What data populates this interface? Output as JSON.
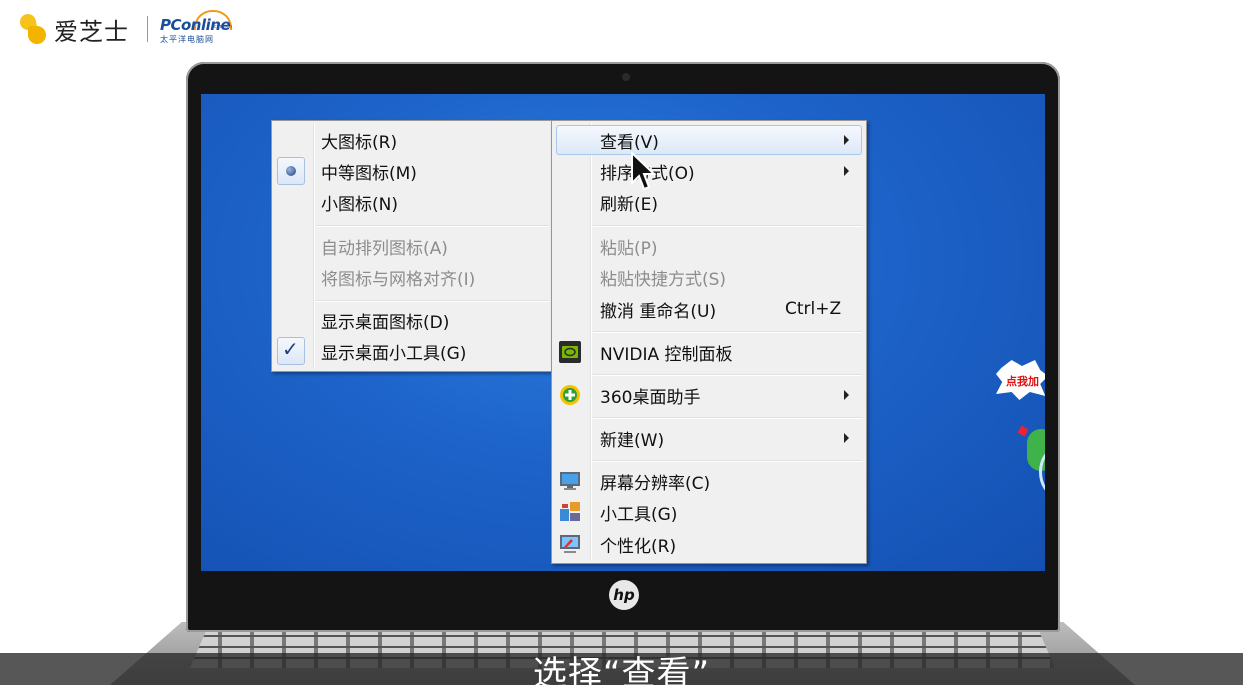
{
  "brand": {
    "aizhishi": "爱芝士",
    "pconline_main": "PConline",
    "pconline_sub": "太平洋电脑网",
    "pconline_domain": "com.cn"
  },
  "sticker_text": "点我加",
  "submenu_view": {
    "items": [
      {
        "label": "大图标(R)",
        "state": "normal"
      },
      {
        "label": "中等图标(M)",
        "state": "normal",
        "selected_radio": true
      },
      {
        "label": "小图标(N)",
        "state": "normal"
      },
      {
        "label": "自动排列图标(A)",
        "state": "disabled"
      },
      {
        "label": "将图标与网格对齐(I)",
        "state": "disabled"
      },
      {
        "label": "显示桌面图标(D)",
        "state": "normal"
      },
      {
        "label": "显示桌面小工具(G)",
        "state": "normal",
        "checked": true
      }
    ]
  },
  "context_menu": {
    "items": [
      {
        "label": "查看(V)",
        "has_submenu": true,
        "highlighted": true
      },
      {
        "label": "排序方式(O)",
        "has_submenu": true
      },
      {
        "label": "刷新(E)"
      },
      {
        "label": "粘贴(P)",
        "state": "disabled"
      },
      {
        "label": "粘贴快捷方式(S)",
        "state": "disabled"
      },
      {
        "label": "撤消 重命名(U)",
        "shortcut": "Ctrl+Z"
      },
      {
        "label": "NVIDIA 控制面板",
        "icon": "nvidia-icon"
      },
      {
        "label": "360桌面助手",
        "icon": "360-plus-icon",
        "has_submenu": true
      },
      {
        "label": "新建(W)",
        "has_submenu": true
      },
      {
        "label": "屏幕分辨率(C)",
        "icon": "monitor-icon"
      },
      {
        "label": "小工具(G)",
        "icon": "gadgets-icon"
      },
      {
        "label": "个性化(R)",
        "icon": "personalize-icon"
      }
    ]
  },
  "subtitle": "选择“查看”",
  "colors": {
    "desktop": "#1d63c9",
    "menu_bg": "#f0f0f0",
    "highlight": "#dde9f7",
    "disabled_text": "#8d8d8d"
  }
}
